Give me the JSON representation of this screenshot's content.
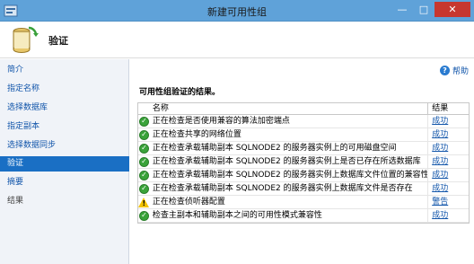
{
  "window": {
    "title": "新建可用性组",
    "controls": {
      "minimize": "—",
      "maximize": "□",
      "close": "✕"
    }
  },
  "header": {
    "title": "验证",
    "icon": "database-wizard-icon"
  },
  "sidebar": {
    "items": [
      {
        "label": "简介",
        "state": "link"
      },
      {
        "label": "指定名称",
        "state": "link"
      },
      {
        "label": "选择数据库",
        "state": "link"
      },
      {
        "label": "指定副本",
        "state": "link"
      },
      {
        "label": "选择数据同步",
        "state": "link"
      },
      {
        "label": "验证",
        "state": "active"
      },
      {
        "label": "摘要",
        "state": "link"
      },
      {
        "label": "结果",
        "state": "disabled"
      }
    ]
  },
  "main": {
    "help_label": "帮助",
    "section_title": "可用性组验证的结果。",
    "grid": {
      "col_name": "名称",
      "col_result": "结果",
      "rows": [
        {
          "status": "success",
          "name": "正在检查是否使用兼容的算法加密端点",
          "result": "成功"
        },
        {
          "status": "success",
          "name": "正在检查共享的网络位置",
          "result": "成功"
        },
        {
          "status": "success",
          "name": "正在检查承载辅助副本 SQLNODE2 的服务器实例上的可用磁盘空间",
          "result": "成功"
        },
        {
          "status": "success",
          "name": "正在检查承载辅助副本 SQLNODE2 的服务器实例上是否已存在所选数据库",
          "result": "成功"
        },
        {
          "status": "success",
          "name": "正在检查承载辅助副本 SQLNODE2 的服务器实例上数据库文件位置的兼容性",
          "result": "成功"
        },
        {
          "status": "success",
          "name": "正在检查承载辅助副本 SQLNODE2 的服务器实例上数据库文件是否存在",
          "result": "成功"
        },
        {
          "status": "warning",
          "name": "正在检查侦听器配置",
          "result": "警告"
        },
        {
          "status": "success",
          "name": "检查主副本和辅助副本之间的可用性模式兼容性",
          "result": "成功"
        }
      ]
    }
  },
  "colors": {
    "titlebar": "#5fa2d9",
    "active_nav": "#1a6fc4",
    "link": "#1155aa",
    "success": "#3aa33a",
    "warning": "#f2c200"
  }
}
